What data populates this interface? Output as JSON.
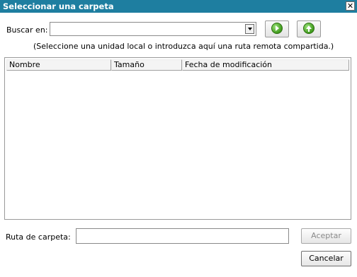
{
  "window": {
    "title": "Seleccionar una carpeta",
    "close_glyph": "✕"
  },
  "lookin": {
    "label": "Buscar en:",
    "value": "",
    "hint": "(Seleccione una unidad local o introduzca aquí una ruta remota compartida.)"
  },
  "nav": {
    "go_icon": "go-arrow-icon",
    "up_icon": "up-folder-icon"
  },
  "list": {
    "columns": [
      "Nombre",
      "Tamaño",
      "Fecha de modificación"
    ],
    "rows": []
  },
  "folder_path": {
    "label": "Ruta de carpeta:",
    "value": ""
  },
  "buttons": {
    "accept": "Aceptar",
    "cancel": "Cancelar"
  },
  "colors": {
    "titlebar": "#1e7ea0"
  }
}
